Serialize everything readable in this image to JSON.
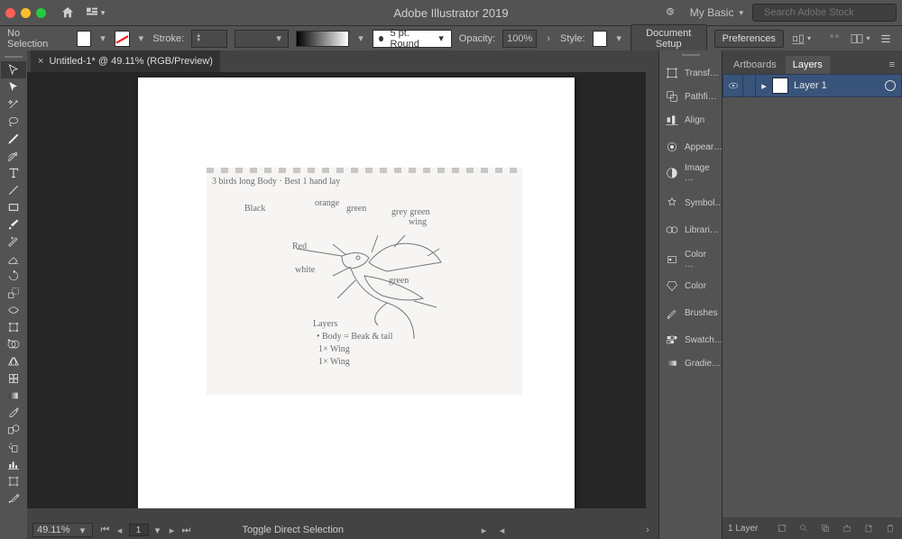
{
  "app": {
    "title": "Adobe Illustrator 2019"
  },
  "workspace": {
    "name": "My Basic"
  },
  "stock_search": {
    "placeholder": "Search Adobe Stock"
  },
  "control": {
    "selection": "No Selection",
    "stroke_label": "Stroke:",
    "stroke_weight": "",
    "brush_label": "5 pt. Round",
    "opacity_label": "Opacity:",
    "opacity_value": "100%",
    "style_label": "Style:",
    "doc_setup": "Document Setup",
    "preferences": "Preferences"
  },
  "doc_tab": {
    "title": "Untitled-1* @ 49.11% (RGB/Preview)"
  },
  "status": {
    "zoom": "49.11%",
    "page": "1",
    "hint": "Toggle Direct Selection"
  },
  "dock_items": [
    {
      "label": "Transf…",
      "icon": "transform-icon"
    },
    {
      "label": "Pathfi…",
      "icon": "pathfinder-icon"
    },
    {
      "label": "Align",
      "icon": "align-icon"
    },
    {
      "label": "Appear…",
      "icon": "appearance-icon"
    },
    {
      "label": "Image …",
      "icon": "imagetrace-icon"
    },
    {
      "label": "Symbol…",
      "icon": "symbols-icon"
    },
    {
      "label": "Librari…",
      "icon": "libraries-icon"
    },
    {
      "label": "Color …",
      "icon": "colorguide-icon"
    },
    {
      "label": "Color",
      "icon": "color-icon"
    },
    {
      "label": "Brushes",
      "icon": "brushes-icon"
    },
    {
      "label": "Swatch…",
      "icon": "swatches-icon"
    },
    {
      "label": "Gradie…",
      "icon": "gradient-icon"
    }
  ],
  "panel_tabs": {
    "artboards": "Artboards",
    "layers": "Layers"
  },
  "layers": [
    {
      "name": "Layer 1",
      "visible": true,
      "locked": false
    }
  ],
  "layer_footer_count": "1 Layer",
  "sketch": {
    "top_note": "3 birds long Body · Best 1 hand lay",
    "annot": {
      "black": "Black",
      "orange": "orange",
      "green": "green",
      "red": "Red",
      "white": "white",
      "grey_green": "grey green",
      "wing": "wing",
      "green2": "green"
    },
    "layers_note1": "Layers",
    "layers_note2": "• Body = Beak & tail",
    "layers_note3": "1× Wing",
    "layers_note4": "1× Wing"
  }
}
